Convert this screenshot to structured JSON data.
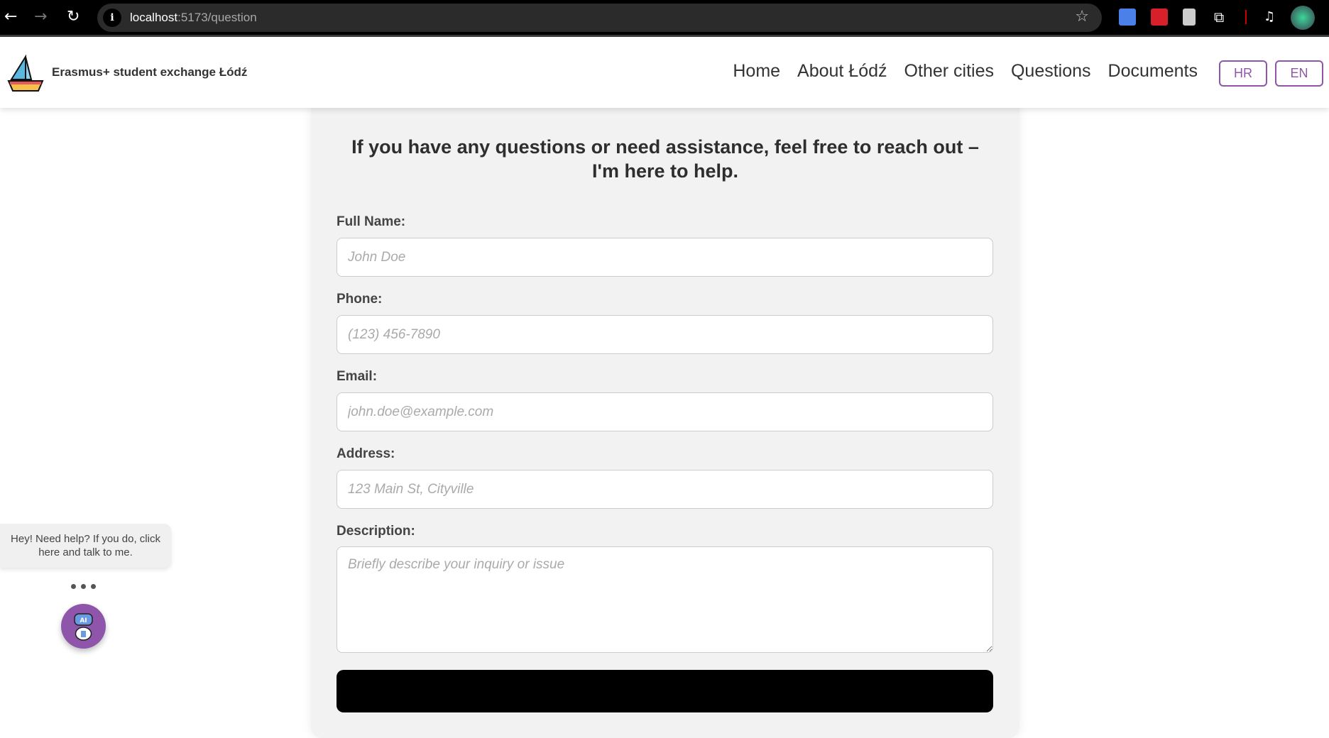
{
  "browser": {
    "url_host": "localhost",
    "url_path": ":5173/question"
  },
  "header": {
    "brand": "Erasmus+ student exchange Łódź",
    "nav": [
      "Home",
      "About Łódź",
      "Other cities",
      "Questions",
      "Documents"
    ],
    "lang": [
      "HR",
      "EN"
    ],
    "accent": "#8e55aa"
  },
  "form": {
    "heading": "If you have any questions or need assistance, feel free to reach out – I'm here to help.",
    "fields": [
      {
        "label": "Full Name:",
        "placeholder": "John Doe"
      },
      {
        "label": "Phone:",
        "placeholder": "(123) 456-7890"
      },
      {
        "label": "Email:",
        "placeholder": "john.doe@example.com"
      },
      {
        "label": "Address:",
        "placeholder": "123 Main St, Cityville"
      },
      {
        "label": "Description:",
        "placeholder": "Briefly describe your inquiry or issue"
      }
    ]
  },
  "chat": {
    "bubble": "Hey! Need help? If you do, click here and talk to me.",
    "icon": "ai-robot-icon"
  }
}
